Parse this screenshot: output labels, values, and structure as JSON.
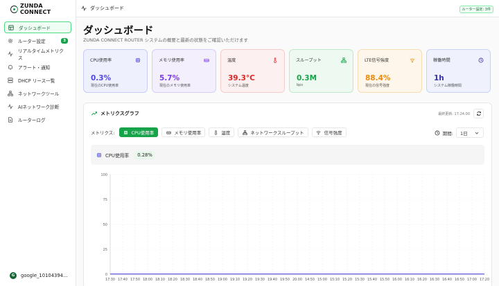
{
  "app": {
    "logo_text": "ZUNDA CONNECT"
  },
  "sidebar": {
    "items": [
      {
        "label": "ダッシュボード",
        "icon": "dashboard-icon"
      },
      {
        "label": "ルーター設定",
        "icon": "gear-icon",
        "badge": "3"
      },
      {
        "label": "リアルタイムメトリクス",
        "icon": "activity-icon"
      },
      {
        "label": "アラート・通知",
        "icon": "bell-icon"
      },
      {
        "label": "DHCP リース一覧",
        "icon": "server-icon"
      },
      {
        "label": "ネットワークツール",
        "icon": "network-icon"
      },
      {
        "label": "AIネットワーク診断",
        "icon": "activity-icon"
      },
      {
        "label": "ルーターログ",
        "icon": "file-icon"
      }
    ],
    "user": {
      "initial": "G",
      "name": "google_10104394..."
    }
  },
  "topbar": {
    "title": "ダッシュボード",
    "badge": "ルーター設定: 3件"
  },
  "page": {
    "title": "ダッシュボード",
    "subtitle": "ZUNDA CONNECT ROUTER システムの概要と最新の状態をご確認いただけます"
  },
  "cards": [
    {
      "label": "CPU使用率",
      "value": "0.3%",
      "desc": "現在のCPU使用率",
      "color": "#4f46e5",
      "bg": "#eef0fd",
      "border": "#c7cdf7",
      "icon": "cpu-icon"
    },
    {
      "label": "メモリ使用率",
      "value": "5.7%",
      "desc": "現在のメモリ使用率",
      "color": "#7c3aed",
      "bg": "#f3effd",
      "border": "#d9cdf7",
      "icon": "memory-icon"
    },
    {
      "label": "温度",
      "value": "39.3°C",
      "desc": "システム温度",
      "color": "#dc2626",
      "bg": "#fdf0f0",
      "border": "#f5cccc",
      "icon": "thermometer-icon"
    },
    {
      "label": "スループット",
      "value": "0.3M",
      "desc": "bps",
      "color": "#16a34a",
      "bg": "#eefaf1",
      "border": "#bfe8cb",
      "icon": "network-icon"
    },
    {
      "label": "LTE信号強度",
      "value": "88.4%",
      "desc": "現在の信号強度",
      "color": "#ea8a0c",
      "bg": "#fef6ea",
      "border": "#f6dcb3",
      "icon": "wifi-icon"
    },
    {
      "label": "稼働時間",
      "value": "1h",
      "desc": "システム稼働時間",
      "color": "#3730a3",
      "bg": "#eff2fd",
      "border": "#c9d2f5",
      "icon": "clock-icon"
    }
  ],
  "metrics": {
    "title": "メトリクスグラフ",
    "last_update": "最終更新: 17:24:00",
    "metrics_label": "メトリクス:",
    "buttons": [
      {
        "label": "CPU使用率",
        "icon": "cpu-icon",
        "active": true
      },
      {
        "label": "メモリ使用率",
        "icon": "memory-icon",
        "active": false
      },
      {
        "label": "温度",
        "icon": "thermometer-icon",
        "active": false
      },
      {
        "label": "ネットワークスループット",
        "icon": "network-icon",
        "active": false
      },
      {
        "label": "信号強度",
        "icon": "wifi-icon",
        "active": false
      }
    ],
    "period_label": "期間:",
    "period_value": "1日",
    "current_label": "CPU使用率",
    "current_value": "0.28%"
  },
  "chart_data": {
    "type": "line",
    "title": "",
    "xlabel": "",
    "ylabel": "",
    "ylim": [
      0,
      100
    ],
    "yticks": [
      0,
      25,
      50,
      75,
      100
    ],
    "categories": [
      "17:30",
      "17:40",
      "17:50",
      "18:00",
      "18:10",
      "18:20",
      "18:30",
      "18:40",
      "18:50",
      "19:00",
      "19:10",
      "19:20",
      "19:30",
      "19:40",
      "19:50",
      "20:00",
      "14:50",
      "15:00",
      "15:10",
      "15:20",
      "15:30",
      "15:40",
      "15:50",
      "16:00",
      "16:10",
      "16:20",
      "16:30",
      "16:40",
      "16:50",
      "17:00",
      "17:20"
    ],
    "series": [
      {
        "values": [
          0.3,
          0.3,
          0.3,
          0.3,
          0.3,
          0.3,
          0.3,
          0.3,
          0.3,
          0.3,
          0.3,
          0.3,
          0.3,
          0.3,
          0.3,
          0.3,
          0.3,
          0.3,
          0.3,
          0.3,
          0.3,
          0.3,
          0.3,
          0.3,
          0.3,
          0.3,
          0.3,
          0.3,
          0.3,
          0.3,
          0.3
        ]
      }
    ],
    "grid": true,
    "line_color": "#4f46e5"
  }
}
